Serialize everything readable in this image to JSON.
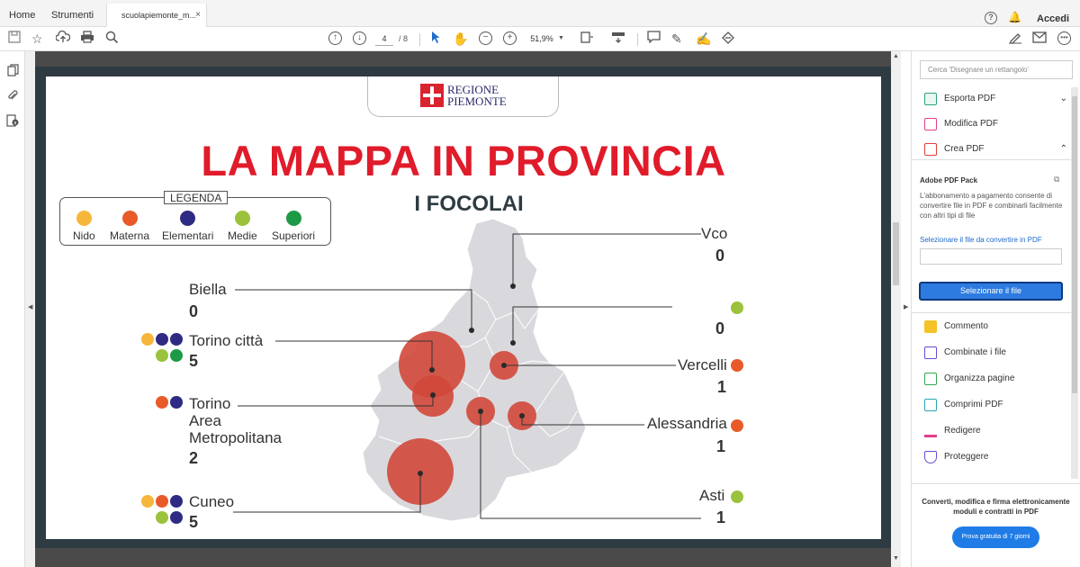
{
  "tabs": {
    "home": "Home",
    "tools": "Strumenti",
    "document": "scuolapiemonte_m...",
    "close": "×"
  },
  "header": {
    "help_icon": "help-icon",
    "bell_icon": "bell-icon",
    "signin": "Accedi"
  },
  "toolbar": {
    "page_current": "4",
    "page_total": "/ 8",
    "zoom": "51,9%",
    "icons": [
      "save-icon",
      "star-icon",
      "cloud-upload-icon",
      "print-icon",
      "zoom-search-icon",
      "page-up-icon",
      "page-down-icon",
      "cursor-icon",
      "hand-icon",
      "zoom-out-icon",
      "zoom-in-icon",
      "fit-page-icon",
      "scroll-mode-icon",
      "comment-icon",
      "pen-icon",
      "sign-icon",
      "share-icon",
      "email-icon",
      "more-icon"
    ]
  },
  "leftbar": {
    "icons": [
      "pages-icon",
      "attachment-icon",
      "info-icon"
    ]
  },
  "slide": {
    "logo_line1": "REGIONE",
    "logo_line2": "PIEMONTE",
    "title": "LA MAPPA IN PROVINCIA",
    "subtitle": "I FOCOLAI",
    "legend": {
      "title": "LEGENDA",
      "items": [
        {
          "label": "Nido",
          "color": "#f6b63b"
        },
        {
          "label": "Materna",
          "color": "#e85a28"
        },
        {
          "label": "Elementari",
          "color": "#2f2a82"
        },
        {
          "label": "Medie",
          "color": "#9bc23c"
        },
        {
          "label": "Superiori",
          "color": "#1d9a46"
        }
      ]
    },
    "provinces": [
      {
        "name": "Vco",
        "value": "0"
      },
      {
        "name": "Biella",
        "value": "0"
      },
      {
        "name": "",
        "value": "0"
      },
      {
        "name": "Torino città",
        "value": "5"
      },
      {
        "name": "Vercelli",
        "value": "1"
      },
      {
        "name": "Torino Area Metropolitana",
        "name_lines": [
          "Torino",
          "Area",
          "Metropolitana"
        ],
        "value": "2"
      },
      {
        "name": "Alessandria",
        "value": "1"
      },
      {
        "name": "Cuneo",
        "value": "5"
      },
      {
        "name": "Asti",
        "value": "1"
      }
    ],
    "colors": {
      "map_fill": "#d9d9dd",
      "bubble": "#d0483a",
      "frame": "#2e3b42",
      "title_red": "#e01b2a"
    }
  },
  "rightpane": {
    "search_placeholder": "Cerca 'Disegnare un rettangolo'",
    "tools_top": [
      {
        "label": "Esporta PDF",
        "icon": "export-pdf-icon",
        "chevron": "⌄"
      },
      {
        "label": "Modifica PDF",
        "icon": "edit-pdf-icon",
        "chevron": ""
      },
      {
        "label": "Crea PDF",
        "icon": "create-pdf-icon",
        "chevron": "⌃"
      }
    ],
    "pack": {
      "title": "Adobe PDF Pack",
      "desc": "L'abbonamento a pagamento consente di convertire file in PDF e combinarli facilmente con altri tipi di file",
      "link": "Selezionare il file da convertire in PDF",
      "button": "Selezionare il file"
    },
    "tools_bottom": [
      {
        "label": "Commento",
        "icon": "comment-tool-icon"
      },
      {
        "label": "Combinate i file",
        "icon": "combine-files-icon"
      },
      {
        "label": "Organizza pagine",
        "icon": "organize-pages-icon"
      },
      {
        "label": "Comprimi PDF",
        "icon": "compress-pdf-icon"
      },
      {
        "label": "Redigere",
        "icon": "redact-icon"
      },
      {
        "label": "Proteggere",
        "icon": "protect-icon"
      }
    ],
    "promo_text": "Converti, modifica e firma elettronicamente moduli e contratti in PDF",
    "promo_button": "Prova gratuita di 7 giorni"
  }
}
